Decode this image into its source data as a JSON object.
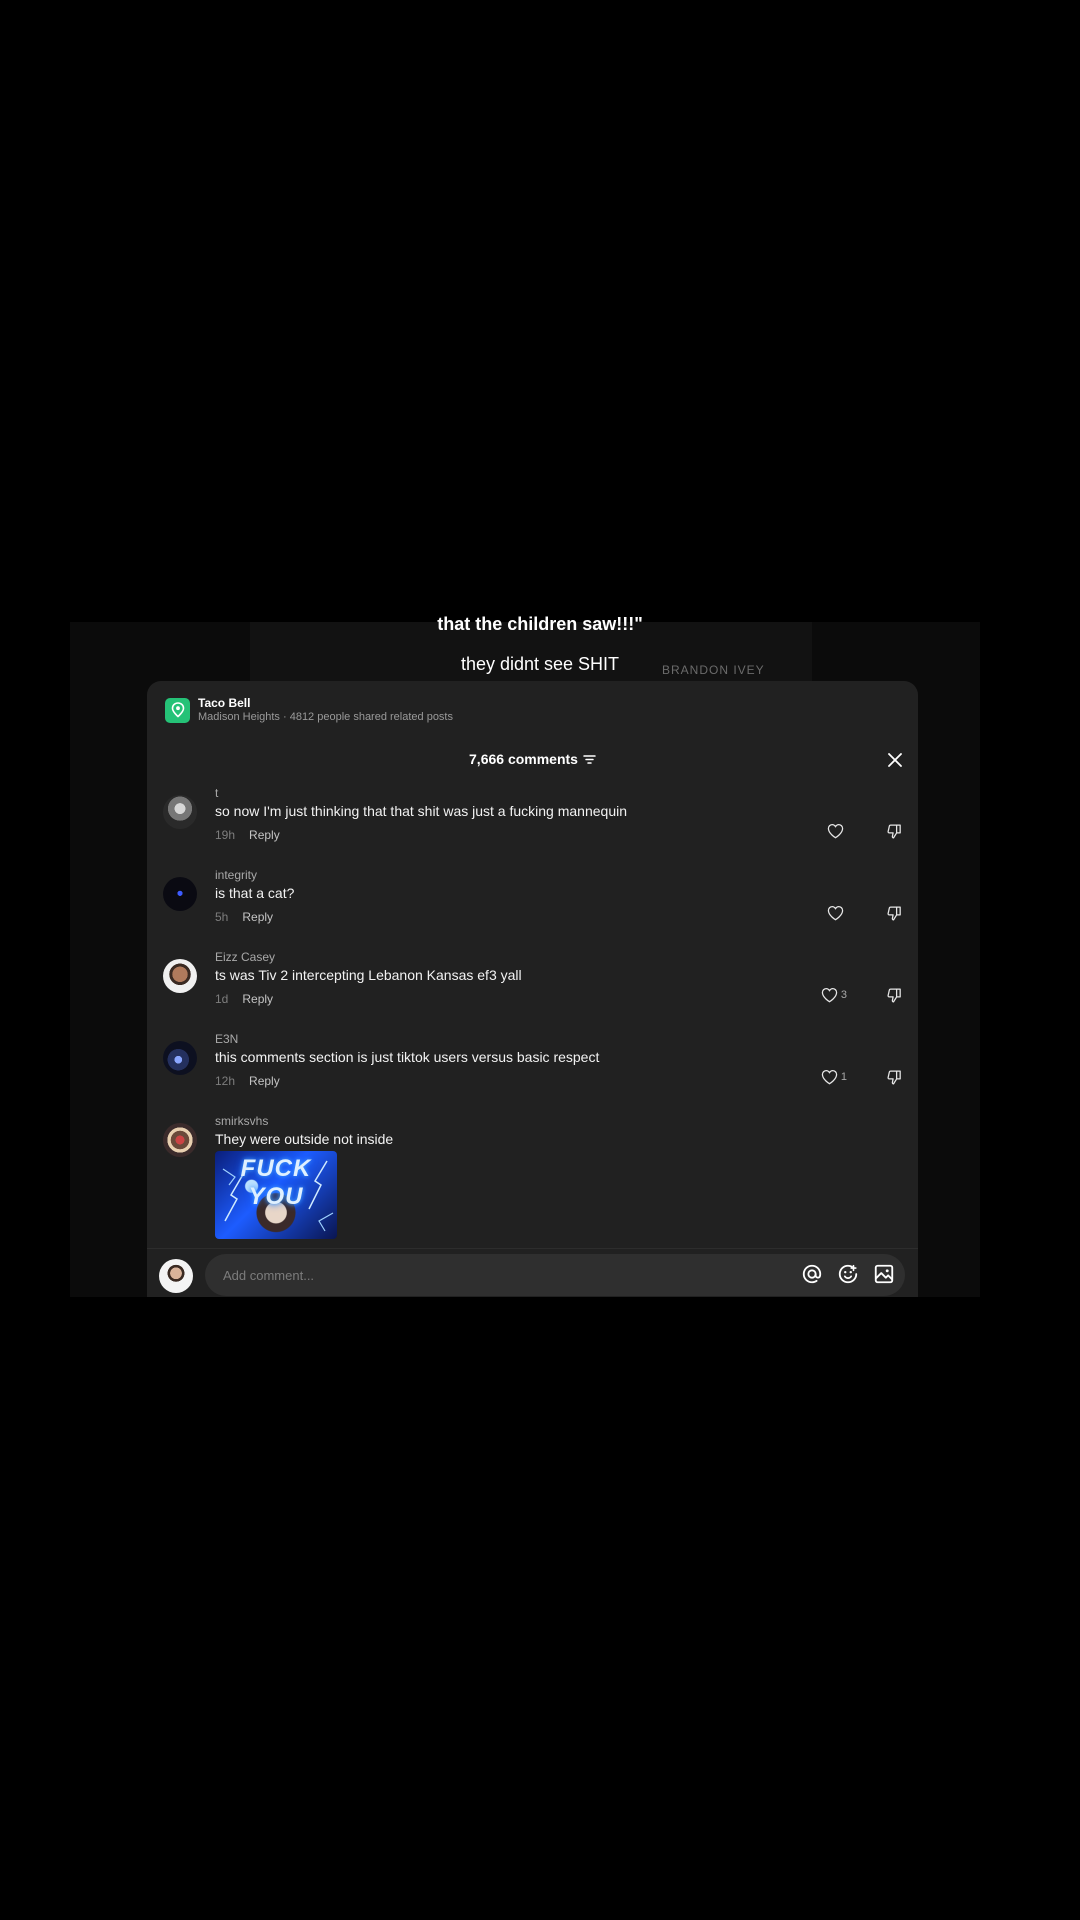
{
  "video": {
    "caption_top": "that the children saw!!!\"",
    "caption_bottom": "they didnt see SHIT",
    "watermark": "BRANDON IVEY"
  },
  "location": {
    "name": "Taco Bell",
    "detail": "Madison Heights · 4812 people shared related posts"
  },
  "header": {
    "comment_count": "7,666 comments"
  },
  "comments": [
    {
      "user": "t",
      "text": "so now I'm just thinking that that shit was just a fucking mannequin",
      "time": "19h",
      "reply": "Reply",
      "likes": ""
    },
    {
      "user": "integrity",
      "text": "is that a cat?",
      "time": "5h",
      "reply": "Reply",
      "likes": ""
    },
    {
      "user": "Eizz Casey",
      "text": "ts was Tiv 2 intercepting Lebanon Kansas ef3 yall",
      "time": "1d",
      "reply": "Reply",
      "likes": "3"
    },
    {
      "user": "E3N",
      "text": "this comments section is just tiktok users versus basic respect",
      "time": "12h",
      "reply": "Reply",
      "likes": "1"
    },
    {
      "user": "smirksvhs",
      "text": "They were outside not inside",
      "sticker_text": "FUCK YOU"
    }
  ],
  "composer": {
    "placeholder": "Add comment..."
  },
  "colors": {
    "background": "#000000",
    "panel": "#212121",
    "location_icon": "#25c277"
  }
}
